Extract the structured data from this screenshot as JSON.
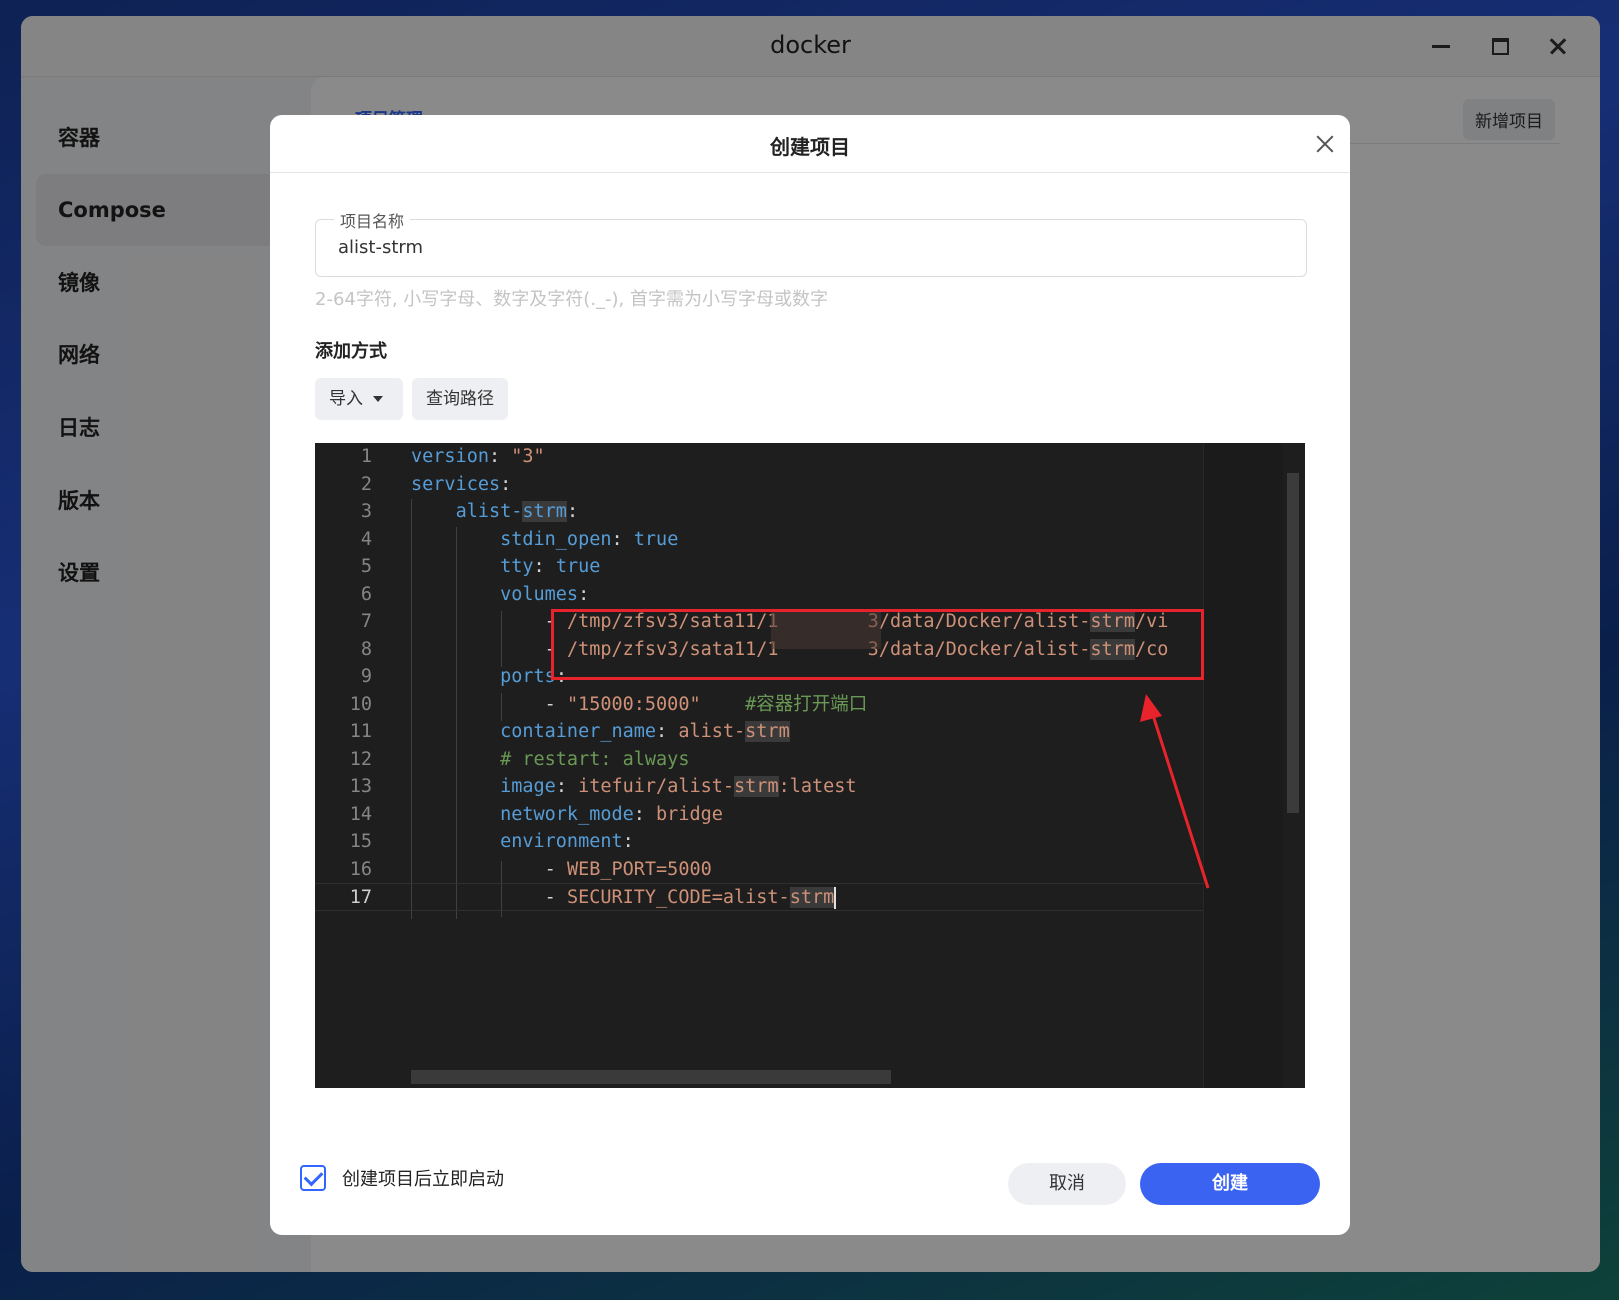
{
  "window": {
    "title": "docker"
  },
  "sidebar": {
    "items": [
      {
        "label": "容器"
      },
      {
        "label": "Compose"
      },
      {
        "label": "镜像"
      },
      {
        "label": "网络"
      },
      {
        "label": "日志"
      },
      {
        "label": "版本"
      },
      {
        "label": "设置"
      }
    ],
    "active": "Compose"
  },
  "content": {
    "tab_label": "项目管理",
    "add_button": "新增项目"
  },
  "dialog": {
    "title": "创建项目",
    "name_field": {
      "label": "项目名称",
      "value": "alist-strm"
    },
    "hint": "2-64字符, 小写字母、数字及字符(._-), 首字需为小写字母或数字",
    "method_title": "添加方式",
    "import_button": "导入",
    "query_path_button": "查询路径",
    "editor": {
      "line_numbers": [
        "1",
        "2",
        "3",
        "4",
        "5",
        "6",
        "7",
        "8",
        "9",
        "10",
        "11",
        "12",
        "13",
        "14",
        "15",
        "16",
        "17"
      ],
      "current_line": 17
    },
    "autostart_checked": true,
    "autostart_label": "创建项目后立即启动",
    "cancel_button": "取消",
    "create_button": "创建"
  },
  "colors": {
    "accent": "#3a63f2",
    "annotation": "#e8232b",
    "editor_bg": "#1e1e1e"
  }
}
